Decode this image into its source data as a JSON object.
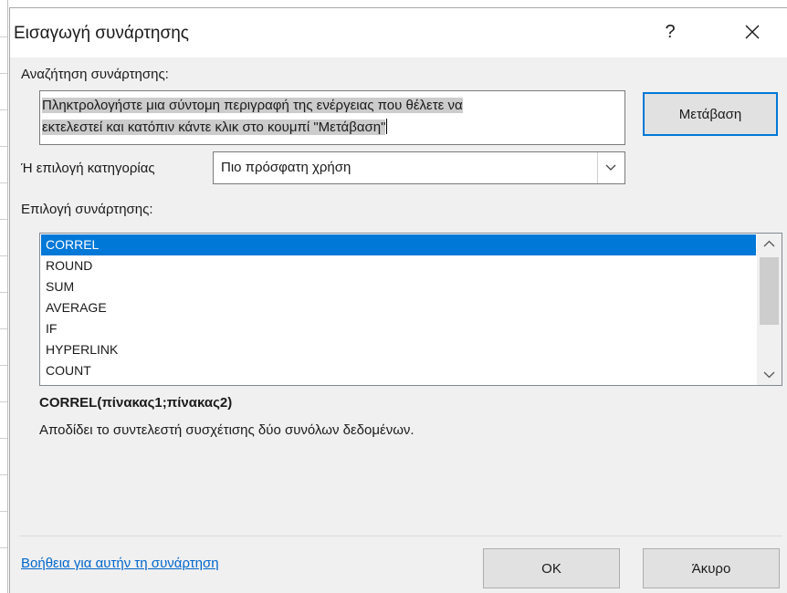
{
  "window": {
    "title": "Εισαγωγή συνάρτησης",
    "help_glyph": "?",
    "close_icon": "close-icon"
  },
  "search": {
    "label": "Αναζήτηση συνάρτησης:",
    "value_line1": "Πληκτρολογήστε μια σύντομη περιγραφή της ενέργειας που θέλετε να",
    "value_line2": "εκτελεστεί και κατόπιν κάντε κλικ στο κουμπί \"Μετάβαση\"",
    "go_button": "Μετάβαση"
  },
  "category": {
    "label": "Ή επιλογή κατηγορίας",
    "selected": "Πιο πρόσφατη χρήση"
  },
  "function_list": {
    "label": "Επιλογή συνάρτησης:",
    "items": [
      "CORREL",
      "ROUND",
      "SUM",
      "AVERAGE",
      "IF",
      "HYPERLINK",
      "COUNT"
    ],
    "selected_index": 0
  },
  "details": {
    "signature": "CORREL(πίνακας1;πίνακας2)",
    "description": "Αποδίδει το συντελεστή συσχέτισης δύο συνόλων δεδομένων."
  },
  "footer": {
    "help_link": "Βοήθεια για αυτήν τη συνάρτηση",
    "ok_button": "OK",
    "cancel_button": "Άκυρο"
  },
  "colors": {
    "accent": "#0078d7",
    "link": "#0066cc",
    "dialog_bg": "#f0f0f0"
  }
}
